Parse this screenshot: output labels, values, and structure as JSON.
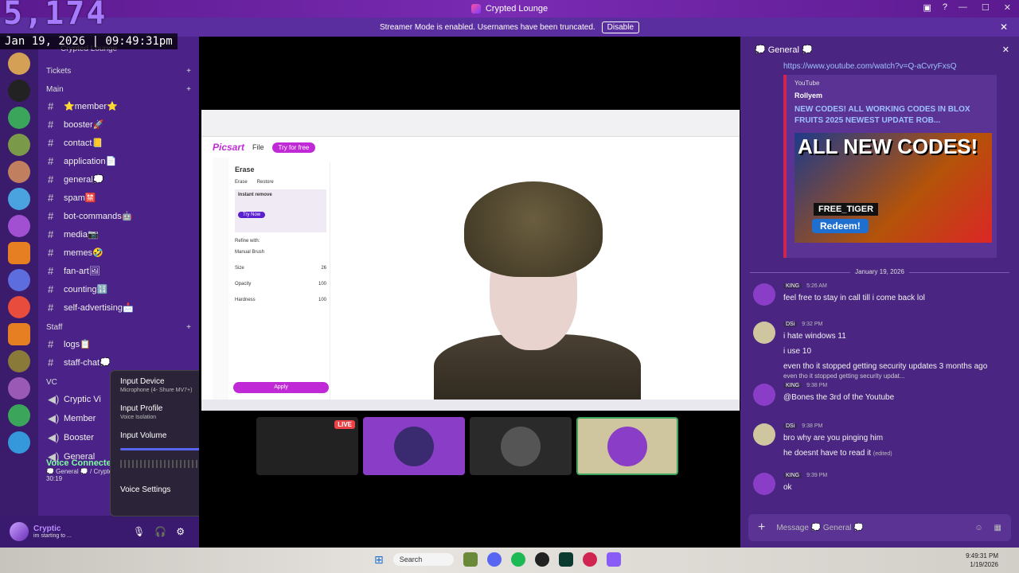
{
  "app": {
    "title": "Crypted Lounge"
  },
  "overlay": {
    "counter": "5,174",
    "datetime": "Jan 19, 2026 | 09:49:31pm"
  },
  "banner": {
    "text": "Streamer Mode is enabled. Usernames have been truncated.",
    "button": "Disable"
  },
  "server": {
    "name": "Crypted Lounge"
  },
  "categories": {
    "tickets": "Tickets",
    "main": "Main",
    "staff": "Staff",
    "vc": "VC"
  },
  "main_channels": [
    "⭐member⭐",
    "booster🚀",
    "contact📒",
    "application📄",
    "general💭",
    "spam🈲",
    "bot-commands🤖",
    "media📷",
    "memes🤣",
    "fan-art🖼",
    "counting🔢",
    "self-advertising📩"
  ],
  "staff_channels": [
    "logs📋",
    "staff-chat💭"
  ],
  "vc_channels": [
    "Cryptic Vi",
    "Member",
    "Booster",
    "General"
  ],
  "voice": {
    "status": "Voice Connected",
    "channel": "💭 General 💭 / Crypted Lou",
    "timer": "30:19"
  },
  "user": {
    "name": "Cryptic",
    "status": "im starting to ..."
  },
  "popup": {
    "input_device": "Input Device",
    "input_device_sub": "Microphone (4- Shure MV7+)",
    "input_profile": "Input Profile",
    "input_profile_sub": "Voice Isolation",
    "input_volume": "Input Volume",
    "voice_settings": "Voice Settings"
  },
  "picsart": {
    "logo": "Picsart",
    "file": "File",
    "try": "Try for free",
    "panel_title": "Erase",
    "erase": "Erase",
    "restore": "Restore",
    "promo_title": "Instant remove",
    "try_now": "Try Now",
    "refine": "Refine with:",
    "brush": "Manual Brush",
    "size": "Size",
    "opacity": "Opacity",
    "hardness": "Hardness",
    "size_val": "26",
    "opacity_val": "100",
    "hardness_val": "100",
    "apply": "Apply"
  },
  "stage": {
    "live": "LIVE"
  },
  "chat": {
    "channel": "💭 General 💭",
    "link": "https://www.youtube.com/watch?v=Q-aCvryFxsQ",
    "embed_provider": "YouTube",
    "embed_author": "Rollyem",
    "embed_title": "NEW CODES! ALL WORKING CODES IN BLOX FRUITS 2025 NEWEST UPDATE ROB...",
    "thumb_big": "ALL NEW CODES!",
    "thumb_tag": "FREE_TIGER",
    "thumb_redeem": "Redeem!",
    "date_divider": "January 19, 2026",
    "messages": [
      {
        "role": "KING",
        "time": "5:26 AM",
        "lines": [
          "feel free to stay in call till i come back lol"
        ]
      },
      {
        "role": "DSi",
        "time": "9:32 PM",
        "lines": [
          "i hate windows 11",
          "i use 10",
          "even tho it stopped getting security updates 3 months ago"
        ]
      },
      {
        "role": "KING",
        "time": "9:38 PM",
        "reply": "even tho it stopped getting security updat...",
        "lines": [
          "@Bones the 3rd of the Youtube"
        ]
      },
      {
        "role": "DSi",
        "time": "9:38 PM",
        "lines": [
          "bro why are you pinging him",
          "he doesnt have to read it"
        ],
        "edited": "(edited)"
      },
      {
        "role": "KING",
        "time": "9:39 PM",
        "lines": [
          "ok"
        ]
      }
    ],
    "placeholder": "Message 💭 General 💭"
  },
  "taskbar": {
    "search": "Search",
    "time": "9:49:31 PM",
    "date": "1/19/2026"
  }
}
